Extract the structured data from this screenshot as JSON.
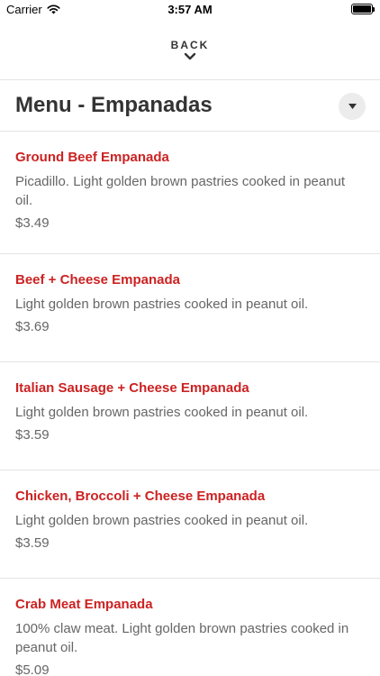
{
  "status_bar": {
    "carrier": "Carrier",
    "time": "3:57 AM"
  },
  "nav": {
    "back_label": "BACK"
  },
  "header": {
    "title": "Menu - Empanadas"
  },
  "menu": {
    "items": [
      {
        "name": "Ground Beef Empanada",
        "description": "Picadillo. Light golden brown pastries cooked in peanut oil.",
        "price": "$3.49"
      },
      {
        "name": "Beef + Cheese Empanada",
        "description": "Light golden brown pastries cooked in peanut oil.",
        "price": "$3.69"
      },
      {
        "name": "Italian Sausage + Cheese Empanada",
        "description": "Light golden brown pastries cooked in peanut oil.",
        "price": "$3.59"
      },
      {
        "name": "Chicken, Broccoli + Cheese Empanada",
        "description": "Light golden brown pastries cooked in peanut oil.",
        "price": "$3.59"
      },
      {
        "name": "Crab Meat Empanada",
        "description": "100% claw meat. Light golden brown pastries cooked in peanut oil.",
        "price": "$5.09"
      }
    ]
  },
  "colors": {
    "accent": "#cc2222",
    "text": "#333333",
    "muted": "#666666",
    "divider": "#e4e4e4"
  }
}
